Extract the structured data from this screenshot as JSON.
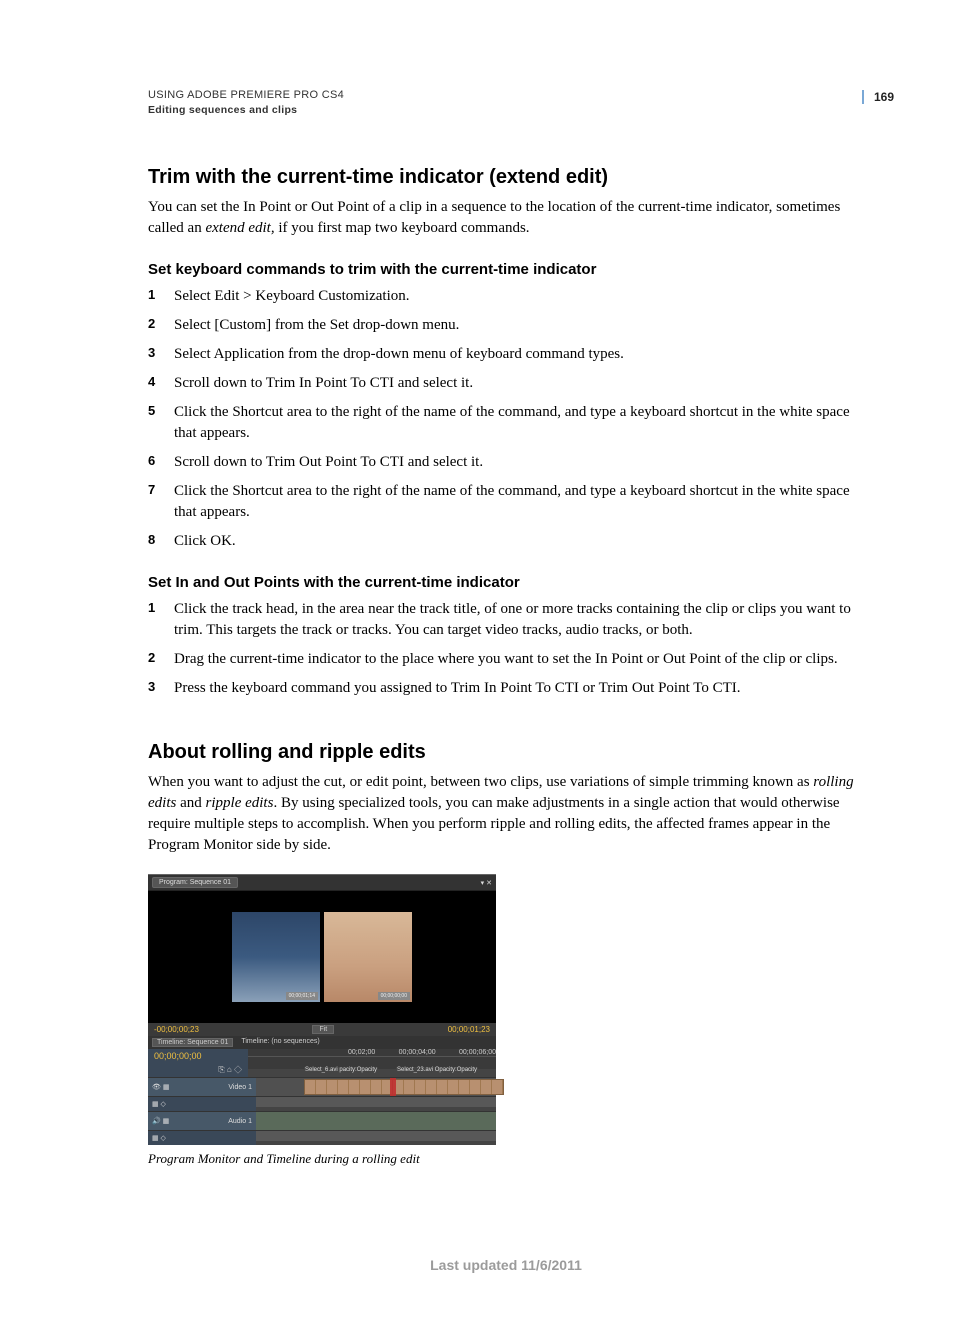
{
  "header": {
    "doc_title": "USING ADOBE PREMIERE PRO CS4",
    "section": "Editing sequences and clips",
    "page_number": "169"
  },
  "s1": {
    "title": "Trim with the current-time indicator (extend edit)",
    "intro_a": "You can set the In Point or Out Point of a clip in a sequence to the location of the current-time indicator, sometimes called an ",
    "intro_em": "extend edit,",
    "intro_b": " if you first map two keyboard commands.",
    "sub1": {
      "title": "Set keyboard commands to trim with the current-time indicator",
      "steps": [
        "Select Edit > Keyboard Customization.",
        "Select [Custom] from the Set drop-down menu.",
        "Select Application from the drop-down menu of keyboard command types.",
        "Scroll down to Trim In Point To CTI and select it.",
        "Click the Shortcut area to the right of the name of the command, and type a keyboard shortcut in the white space that appears.",
        "Scroll down to Trim Out Point To CTI and select it.",
        "Click the Shortcut area to the right of the name of the command, and type a keyboard shortcut in the white space that appears.",
        "Click OK."
      ]
    },
    "sub2": {
      "title": "Set In and Out Points with the current-time indicator",
      "steps": [
        "Click the track head, in the area near the track title, of one or more tracks containing the clip or clips you want to trim. This targets the track or tracks. You can target video tracks, audio tracks, or both.",
        "Drag the current-time indicator to the place where you want to set the In Point or Out Point of the clip or clips.",
        "Press the keyboard command you assigned to Trim In Point To CTI or Trim Out Point To CTI."
      ]
    }
  },
  "s2": {
    "title": "About rolling and ripple edits",
    "intro_a": "When you want to adjust the cut, or edit point, between two clips, use variations of simple trimming known as ",
    "em1": "rolling edits",
    "intro_b": " and ",
    "em2": "ripple edits",
    "intro_c": ". By using specialized tools, you can make adjustments in a single action that would otherwise require multiple steps to accomplish. When you perform ripple and rolling edits, the affected frames appear in the Program Monitor side by side."
  },
  "figure": {
    "caption": "Program Monitor and Timeline during a rolling edit",
    "pm_tab": "Program: Sequence 01",
    "frame_left_tc": "00;00;01;14",
    "frame_right_tc": "00;00;00;00",
    "tc_left": "-00;00;00;23",
    "fit_label": "Fit",
    "tc_right": "00;00;01;23",
    "tl_tab1": "Timeline: Sequence 01",
    "tl_tab2": "Timeline: (no sequences)",
    "tl_time": "00;00;00;00",
    "ruler": [
      "00;02;00",
      "00;00;04;00",
      "00;00;06;00"
    ],
    "video_track": "Video 1",
    "audio_track": "Audio 1",
    "clip_a_label": "Select_6.avi  pacity:Opacity",
    "clip_b_label": "Select_23.avi Opacity:Opacity"
  },
  "footer": "Last updated 11/6/2011"
}
